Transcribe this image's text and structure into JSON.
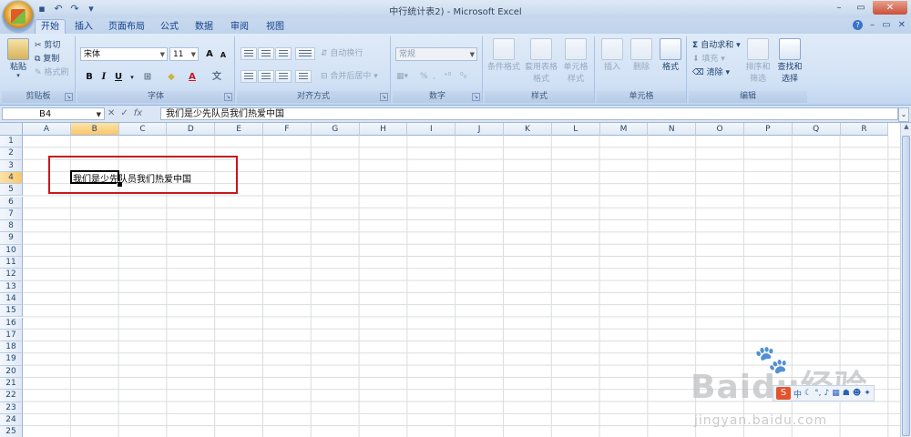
{
  "window": {
    "title": "中行统计表2) - Microsoft Excel"
  },
  "tabs": [
    "开始",
    "插入",
    "页面布局",
    "公式",
    "数据",
    "审阅",
    "视图"
  ],
  "ribbon": {
    "clipboard": {
      "label": "剪贴板",
      "paste": "粘贴",
      "cut": "剪切",
      "copy": "复制",
      "format_painter": "格式刷"
    },
    "font": {
      "label": "字体",
      "font_name": "宋体",
      "font_size": "11",
      "bold": "B",
      "italic": "I",
      "underline": "U"
    },
    "alignment": {
      "label": "对齐方式",
      "wrap_text": "自动换行",
      "merge_center": "合并后居中"
    },
    "number": {
      "label": "数字",
      "format": "常规",
      "percent": "%"
    },
    "styles": {
      "label": "样式",
      "conditional": "条件格式",
      "table_format": "套用表格格式",
      "cell_styles": "单元格样式"
    },
    "cells": {
      "label": "单元格",
      "insert": "插入",
      "delete": "删除",
      "format": "格式"
    },
    "editing": {
      "label": "编辑",
      "autosum": "自动求和",
      "fill": "填充",
      "clear": "清除",
      "sort_filter": "排序和筛选",
      "find_select": "查找和选择"
    }
  },
  "formula_bar": {
    "name_box": "B4",
    "formula": "我们是少先队员我们热爱中国"
  },
  "columns": [
    "A",
    "B",
    "C",
    "D",
    "E",
    "F",
    "G",
    "H",
    "I",
    "J",
    "K",
    "L",
    "M",
    "N",
    "O",
    "P",
    "Q",
    "R"
  ],
  "rows": [
    "1",
    "2",
    "3",
    "4",
    "5",
    "6",
    "7",
    "8",
    "9",
    "10",
    "11",
    "12",
    "13",
    "14",
    "15",
    "16",
    "17",
    "18",
    "19",
    "20",
    "21",
    "22",
    "23",
    "24",
    "25"
  ],
  "selection": {
    "column": "B",
    "row": "4"
  },
  "cell_content": "我们是少先队员我们热爱中国",
  "watermark": {
    "brand": "Baidu经验",
    "url": "jingyan.baidu.com"
  },
  "ime_bar": {
    "logo": "S",
    "mode": "中"
  },
  "colors": {
    "highlight": "#c8161d",
    "ribbon": "#dbe7f6",
    "selected_header": "#f8c66a"
  }
}
